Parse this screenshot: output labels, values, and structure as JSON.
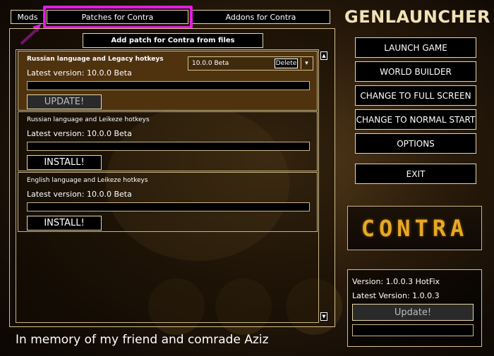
{
  "tabs": {
    "mods": "Mods",
    "patches": "Patches for Contra",
    "addons": "Addons for Contra"
  },
  "add_patch_label": "Add patch for Contra from files",
  "patches": [
    {
      "name": "Russian language and Legacy hotkeys",
      "latest_version": "Latest version: 10.0.0 Beta",
      "action_label": "UPDATE!",
      "selected_version": "10.0.0 Beta",
      "delete_label": "Delete"
    },
    {
      "name": "Russian language and Leikeze hotkeys",
      "latest_version": "Latest version: 10.0.0 Beta",
      "action_label": "INSTALL!"
    },
    {
      "name": "English language and Leikeze hotkeys",
      "latest_version": "Latest version: 10.0.0 Beta",
      "action_label": "INSTALL!"
    }
  ],
  "memory_text": "In memory of my friend and comrade Aziz",
  "app_title": "GENLAUNCHER",
  "menu": [
    "LAUNCH GAME",
    "WORLD BUILDER",
    "CHANGE TO FULL SCREEN",
    "CHANGE TO NORMAL START",
    "OPTIONS",
    "EXIT"
  ],
  "logo_text": "CONTRA",
  "version_info": {
    "version": "Version: 1.0.0.3 HotFix",
    "latest": "Latest Version: 1.0.0.3",
    "update_label": "Update!"
  },
  "icons": {
    "scroll_up": "scroll-up-icon",
    "scroll_down": "scroll-down-icon",
    "dropdown": "chevron-down-icon",
    "annotation_arrow": "arrow-icon"
  },
  "colors": {
    "accent_highlight": "#e01ee0",
    "border_gold": "#d6c28e",
    "selected_item_bg": "#4f330f",
    "logo_orange": "#e6a826"
  }
}
